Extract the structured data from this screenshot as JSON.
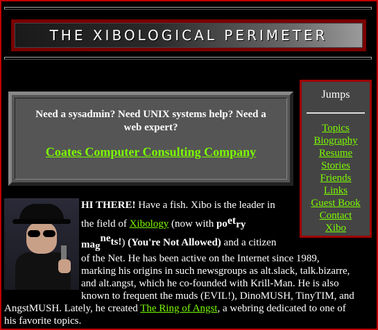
{
  "banner": {
    "title": "THE XIBOLOGICAL PERIMETER"
  },
  "jumps": {
    "title": "Jumps",
    "links": [
      "Topics",
      "Biography",
      "Resume",
      "Stories",
      "Friends",
      "Links",
      "Guest Book",
      "Contact",
      "Xibo"
    ]
  },
  "ad": {
    "text": "Need a sysadmin? Need UNIX systems help? Need a web expert?",
    "link": "Coates Computer Consulting Company"
  },
  "intro": {
    "greeting": "HI THERE!",
    "t1": " Have a fish. Xibo is the leader in",
    "t2": "the field of ",
    "xibology": "Xibology",
    "t3": " (now with ",
    "mag1": "po",
    "mag2": "et",
    "mag3": "ry",
    "mag4": "ma",
    "mag5": "g",
    "mag6": "ne",
    "mag7": "ts!",
    "t4": ") ",
    "not_allowed": "(You're Not Allowed)",
    "t5": " and a citizen",
    "l5": "of the Net. He has been active on the Internet since 1989,",
    "l6": "marking his origins in such newsgroups as alt.slack, talk.bizarre,",
    "l7": "and alt.angst, which he co-founded with Krill-Man. He is also",
    "l8": "known to frequent the muds (EVIL!), DinoMUSH, TinyTIM, and",
    "l9a": "AngstMUSH. Lately, he created ",
    "ring": "The Ring of Angst",
    "l9b": ", a webring dedicated to one of",
    "l10": "his favorite topics."
  }
}
